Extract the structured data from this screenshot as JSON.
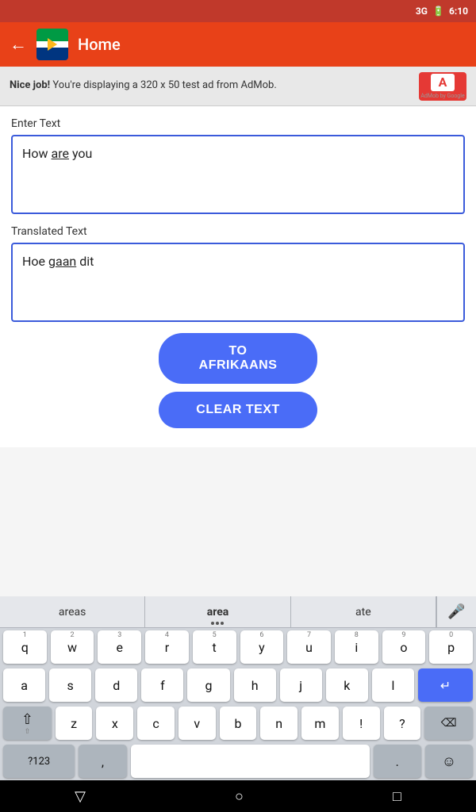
{
  "statusBar": {
    "signal": "3G",
    "time": "6:10",
    "battery": "🔋"
  },
  "appBar": {
    "title": "Home",
    "backLabel": "←"
  },
  "ad": {
    "text": "Nice job! You're displaying a 320 x 50 test ad from AdMob.",
    "logoText": "A",
    "poweredBy": "AdMob by Google"
  },
  "enterTextLabel": "Enter Text",
  "inputText": "How are you",
  "translatedTextLabel": "Translated Text",
  "translatedText": "Hoe gaan dit",
  "buttons": {
    "toAfrikaans": "TO AFRIKAANS",
    "clearText": "CLEAR TEXT"
  },
  "keyboard": {
    "suggestions": [
      "areas",
      "area",
      "ate"
    ],
    "rows": [
      [
        "q",
        "w",
        "e",
        "r",
        "t",
        "y",
        "u",
        "i",
        "o",
        "p"
      ],
      [
        "a",
        "s",
        "d",
        "f",
        "g",
        "h",
        "j",
        "k",
        "l"
      ],
      [
        "z",
        "x",
        "c",
        "v",
        "b",
        "n",
        "m"
      ]
    ],
    "rowNumbers": [
      [
        "1",
        "2",
        "3",
        "4",
        "5",
        "6",
        "7",
        "8",
        "9",
        "0"
      ],
      [
        "",
        "",
        "",
        "",
        "",
        "",
        "",
        "",
        ""
      ],
      [
        "",
        "",
        "",
        "",
        "",
        "",
        ""
      ]
    ],
    "specialKeys": {
      "shift": "⇧",
      "backspace": "⌫",
      "numSym": "?123",
      "comma": ",",
      "space": "",
      "period": ".",
      "emoji": "☺",
      "enter": "↵"
    }
  },
  "navBar": {
    "back": "▽",
    "home": "○",
    "recents": "□"
  }
}
